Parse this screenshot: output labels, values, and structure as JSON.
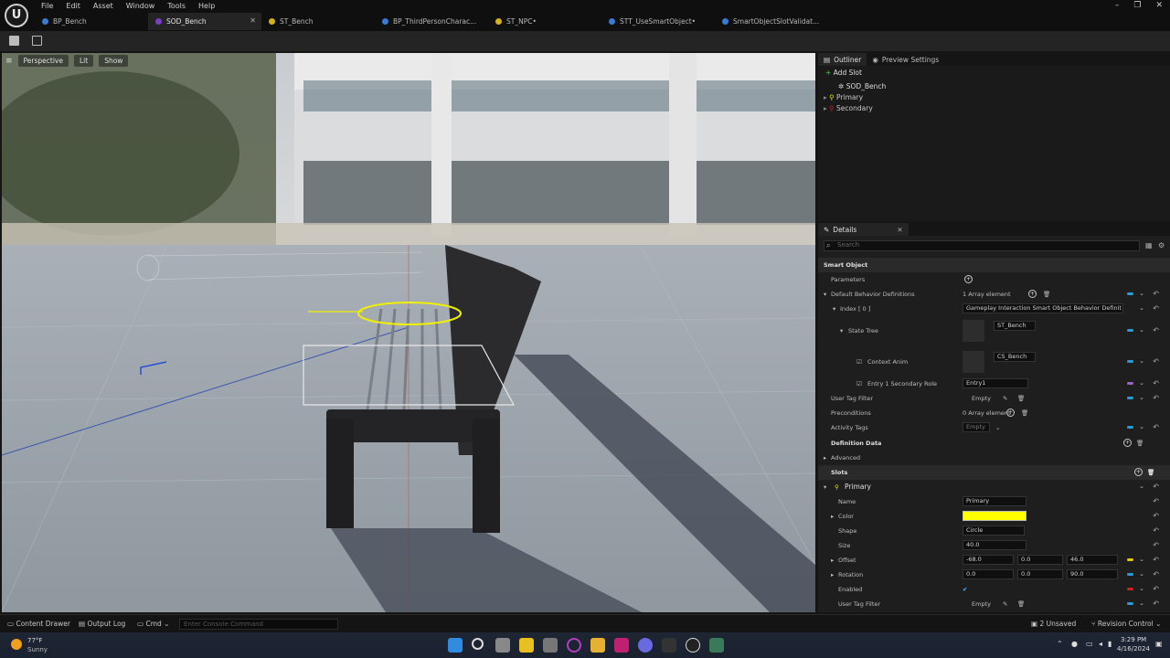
{
  "menu": [
    "File",
    "Edit",
    "Asset",
    "Window",
    "Tools",
    "Help"
  ],
  "tabs": [
    {
      "label": "BP_Bench",
      "color": "#3a7bd5",
      "active": false
    },
    {
      "label": "SOD_Bench",
      "color": "#7a3fc4",
      "active": true
    },
    {
      "label": "ST_Bench",
      "color": "#d4b21c",
      "active": false
    },
    {
      "label": "BP_ThirdPersonCharac...",
      "color": "#3a7bd5",
      "active": false
    },
    {
      "label": "ST_NPC•",
      "color": "#d4b21c",
      "active": false
    },
    {
      "label": "STT_UseSmartObject•",
      "color": "#3a7bd5",
      "active": false
    },
    {
      "label": "SmartObjectSlotValidat...",
      "color": "#3a7bd5",
      "active": false
    }
  ],
  "viewport": {
    "perspective": "Perspective",
    "lit": "Lit",
    "show": "Show"
  },
  "outliner": {
    "tab": "Outliner",
    "preview_tab": "Preview Settings",
    "add_slot": "Add Slot",
    "items": [
      {
        "label": "SOD_Bench",
        "color": "#dddddd"
      },
      {
        "label": "Primary",
        "color": "#e8e800"
      },
      {
        "label": "Secondary",
        "color": "#cc2222"
      }
    ]
  },
  "details": {
    "tab": "Details",
    "search_placeholder": "Search",
    "smart_object": "Smart Object",
    "parameters": "Parameters",
    "default_behavior": "Default Behavior Definitions",
    "array_one": "1 Array element",
    "index0": "Index [ 0 ]",
    "gameplay_interaction": "Gameplay Interaction Smart Object Behavior Definit",
    "state_tree": "State Tree",
    "st_bench": "ST_Bench",
    "context_anim": "Context Anim",
    "cs_bench": "CS_Bench",
    "entry_role": "Entry 1 Secondary Role",
    "entry1": "Entry1",
    "user_tag_filter": "User Tag Filter",
    "empty": "Empty",
    "preconditions": "Preconditions",
    "array_zero": "0 Array element",
    "activity_tags": "Activity Tags",
    "definition_data": "Definition Data",
    "advanced": "Advanced",
    "slots": "Slots",
    "primary": "Primary",
    "name": "Name",
    "name_value": "Primary",
    "color": "Color",
    "color_value": "#ffff00",
    "shape": "Shape",
    "shape_value": "Circle",
    "size": "Size",
    "size_value": "40.0",
    "offset": "Offset",
    "offset_values": [
      "-68.0",
      "0.0",
      "46.0"
    ],
    "rotation": "Rotation",
    "rotation_values": [
      "0.0",
      "0.0",
      "90.0"
    ],
    "enabled": "Enabled",
    "user_tag_filter2": "User Tag Filter"
  },
  "status": {
    "content_drawer": "Content Drawer",
    "output_log": "Output Log",
    "cmd": "Cmd",
    "console_placeholder": "Enter Console Command",
    "unsaved": "2 Unsaved",
    "revision": "Revision Control"
  },
  "taskbar": {
    "temp": "77°F",
    "weather": "Sunny",
    "time": "3:29 PM",
    "date": "4/16/2024"
  }
}
